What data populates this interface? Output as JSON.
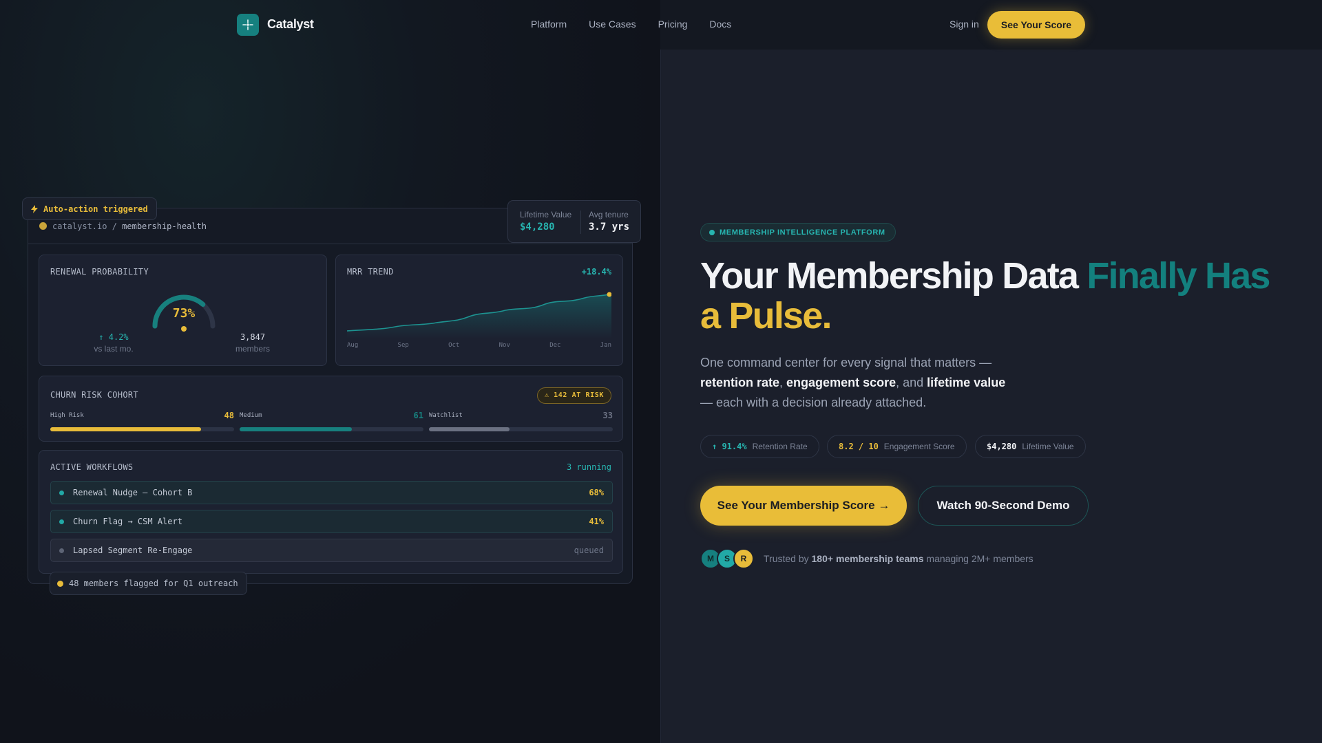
{
  "nav": {
    "brand": "Catalyst",
    "links": [
      "Platform",
      "Use Cases",
      "Pricing",
      "Docs"
    ],
    "signin": "Sign in",
    "cta": "See Your Score"
  },
  "dashboard": {
    "breadcrumb_host": "catalyst.io / ",
    "breadcrumb_page": "membership-health",
    "auto_action": "Auto-action triggered",
    "lifetime": {
      "label": "Lifetime Value",
      "value": "$4,280"
    },
    "tenure": {
      "label": "Avg tenure",
      "value": "3.7 yrs"
    },
    "renewal": {
      "title": "RENEWAL PROBABILITY",
      "percent_label": "73%",
      "percent": 73,
      "delta": "↑ 4.2%",
      "delta_label": "vs last mo.",
      "members": "3,847",
      "members_label": "members"
    },
    "mrr": {
      "title": "MRR TREND",
      "change": "+18.4%",
      "months": [
        "Aug",
        "Sep",
        "Oct",
        "Nov",
        "Dec",
        "Jan"
      ]
    },
    "churn": {
      "title": "CHURN RISK COHORT",
      "at_risk": "⚠ 142 AT RISK",
      "segments": [
        {
          "label": "High Risk",
          "count": "48",
          "fill": 0.82,
          "color": "#e8bc3a"
        },
        {
          "label": "Medium",
          "count": "61",
          "fill": 0.61,
          "color": "#17807e"
        },
        {
          "label": "Watchlist",
          "count": "33",
          "fill": 0.44,
          "color": "#6b7182"
        }
      ]
    },
    "workflows": {
      "title": "ACTIVE WORKFLOWS",
      "running": "3 running",
      "items": [
        {
          "name": "Renewal Nudge — Cohort B",
          "status": "68%"
        },
        {
          "name": "Churn Flag → CSM Alert",
          "status": "41%"
        },
        {
          "name": "Lapsed Segment Re-Engage",
          "status": "queued"
        }
      ]
    },
    "flagged": "48 members flagged for Q1 outreach"
  },
  "hero": {
    "badge": "MEMBERSHIP INTELLIGENCE PLATFORM",
    "headline_a": "Your Membership Data ",
    "headline_b": "Finally Has",
    "headline_c": "a Pulse.",
    "sub_1": "One command center for every signal that matters —",
    "sub_b1": "retention rate",
    "sub_c1": ", ",
    "sub_b2": "engagement score",
    "sub_c2": ", and ",
    "sub_b3": "lifetime value",
    "sub_2": "— each with a decision already attached.",
    "stats": [
      {
        "value": "↑ 91.4%",
        "label": "Retention Rate",
        "color": "#27b5b0"
      },
      {
        "value": "8.2 / 10",
        "label": "Engagement Score",
        "color": "#e8bc3a"
      },
      {
        "value": "$4,280",
        "label": "Lifetime Value",
        "color": "#f2f3f6"
      }
    ],
    "primary_cta": "See Your Membership Score →",
    "secondary_cta": "Watch 90-Second Demo",
    "avatars": [
      "M",
      "S",
      "R"
    ],
    "trusted_pre": "Trusted by ",
    "trusted_bold": "180+ membership teams",
    "trusted_post": " managing 2M+ members"
  }
}
